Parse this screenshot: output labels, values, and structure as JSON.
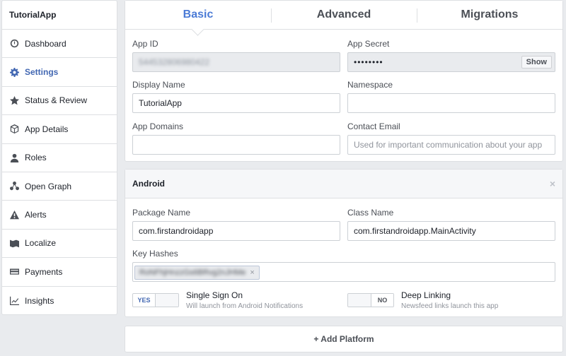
{
  "app_name": "TutorialApp",
  "sidebar": {
    "items": [
      {
        "label": "Dashboard",
        "icon": "dashboard-icon"
      },
      {
        "label": "Settings",
        "icon": "gear-icon",
        "active": true
      },
      {
        "label": "Status & Review",
        "icon": "star-icon"
      },
      {
        "label": "App Details",
        "icon": "cube-icon"
      },
      {
        "label": "Roles",
        "icon": "person-icon"
      },
      {
        "label": "Open Graph",
        "icon": "graph-icon"
      },
      {
        "label": "Alerts",
        "icon": "warning-icon"
      },
      {
        "label": "Localize",
        "icon": "map-icon"
      },
      {
        "label": "Payments",
        "icon": "card-icon"
      },
      {
        "label": "Insights",
        "icon": "chart-icon"
      }
    ]
  },
  "tabs": [
    {
      "label": "Basic",
      "active": true
    },
    {
      "label": "Advanced"
    },
    {
      "label": "Migrations"
    }
  ],
  "basic": {
    "app_id_label": "App ID",
    "app_id_value": "544532806980422",
    "app_secret_label": "App Secret",
    "app_secret_value": "••••••••",
    "show_label": "Show",
    "display_name_label": "Display Name",
    "display_name_value": "TutorialApp",
    "namespace_label": "Namespace",
    "namespace_value": "",
    "app_domains_label": "App Domains",
    "app_domains_value": "",
    "contact_email_label": "Contact Email",
    "contact_email_placeholder": "Used for important communication about your app"
  },
  "android": {
    "title": "Android",
    "close_glyph": "×",
    "package_name_label": "Package Name",
    "package_name_value": "com.firstandroidapp",
    "class_name_label": "Class Name",
    "class_name_value": "com.firstandroidapp.MainActivity",
    "key_hashes_label": "Key Hashes",
    "key_hash_value": "RoNFhjHnzzGs6BRvg2nJHMe",
    "chip_remove_glyph": "×",
    "sso": {
      "title": "Single Sign On",
      "subtitle": "Will launch from Android Notifications",
      "state_label": "YES"
    },
    "deep_linking": {
      "title": "Deep Linking",
      "subtitle": "Newsfeed links launch this app",
      "state_label": "NO"
    }
  },
  "add_platform_label": "+ Add Platform",
  "colors": {
    "accent": "#4267b2",
    "tab_active": "#4b7bd6",
    "background": "#e9ebee"
  }
}
